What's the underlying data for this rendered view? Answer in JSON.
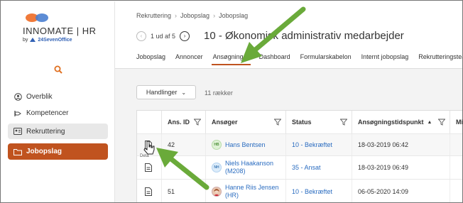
{
  "logo": {
    "brand": "INNOMATE | HR",
    "by_prefix": "by",
    "by_company": "24SevenOffice"
  },
  "sidebar": {
    "items": [
      {
        "label": "Overblik",
        "icon": "person-circle-icon"
      },
      {
        "label": "Kompetencer",
        "icon": "hand-icon"
      },
      {
        "label": "Rekruttering",
        "icon": "id-card-icon"
      },
      {
        "label": "Jobopslag",
        "icon": "folder-icon"
      }
    ]
  },
  "breadcrumb": [
    "Rekruttering",
    "Jobopslag",
    "Jobopslag"
  ],
  "pager": {
    "text": "1 ud af 5"
  },
  "page_title": "10 - Økonomisk administrativ medarbejder",
  "tabs": [
    {
      "label": "Jobopslag"
    },
    {
      "label": "Annoncer"
    },
    {
      "label": "Ansøgninger",
      "active": true
    },
    {
      "label": "Dashboard"
    },
    {
      "label": "Formularskabelon"
    },
    {
      "label": "Internt jobopslag"
    },
    {
      "label": "Rekrutteringsteam"
    }
  ],
  "toolbar": {
    "actions_label": "Handlinger",
    "row_count": "11 rækker"
  },
  "table": {
    "columns": [
      "Ans. ID",
      "Ansøger",
      "Status",
      "Ansøgningstidspunkt",
      "Mi"
    ],
    "rows": [
      {
        "id": "42",
        "initials": "HB",
        "name": "Hans Bentsen",
        "status": "10 - Bekræftet",
        "time": "18-03-2019 06:42"
      },
      {
        "id": "",
        "initials": "NH",
        "name": "Niels Haakanson (M208)",
        "status": "35 - Ansat",
        "time": "18-03-2019 06:49"
      },
      {
        "id": "51",
        "initials": "",
        "name": "Hanne Riis Jensen (HR)",
        "status": "10 - Bekræftet",
        "time": "06-05-2020 14:09"
      }
    ],
    "tooltip": "Deta"
  },
  "colors": {
    "accent": "#c0531f",
    "link": "#2a6cc0",
    "arrow": "#6aaa3a"
  }
}
